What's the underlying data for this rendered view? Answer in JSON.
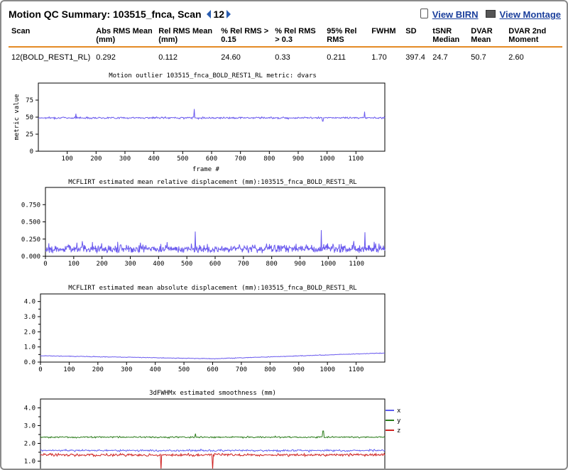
{
  "header": {
    "title_prefix": "Motion QC Summary: 103515_fnca, Scan",
    "scan_number": "12",
    "view_birn": "View BIRN",
    "view_montage": "View Montage"
  },
  "table": {
    "headers": [
      "Scan",
      "Abs RMS Mean (mm)",
      "Rel RMS Mean (mm)",
      "% Rel RMS > 0.15",
      "% Rel RMS > 0.3",
      "95% Rel RMS",
      "FWHM",
      "SD",
      "tSNR Median",
      "DVAR Mean",
      "DVAR 2nd Moment"
    ],
    "rows": [
      [
        "12(BOLD_REST1_RL)",
        "0.292",
        "0.112",
        "24.60",
        "0.33",
        "0.211",
        "1.70",
        "397.4",
        "24.7",
        "50.7",
        "2.60"
      ]
    ]
  },
  "colors": {
    "series": "#6a5aee",
    "x": "#5d5df0",
    "y": "#2c7d1c",
    "z": "#cf2323",
    "accent": "#e48a24"
  },
  "chart_data": [
    {
      "type": "line",
      "title": "Motion outlier 103515_fnca_BOLD_REST1_RL metric: dvars",
      "xlabel": "frame #",
      "ylabel": "metric value",
      "xlim": [
        0,
        1200
      ],
      "ylim": [
        0,
        100
      ],
      "yticks": [
        "0",
        "25",
        "50",
        "75"
      ],
      "xticks": [
        "100",
        "200",
        "300",
        "400",
        "500",
        "600",
        "700",
        "800",
        "900",
        "1000",
        "1100"
      ],
      "series": [
        {
          "values": {
            "base": 49,
            "noise": 1.2,
            "spikes": [
              [
                130,
                55
              ],
              [
                540,
                62
              ],
              [
                985,
                57
              ],
              [
                1130,
                58
              ]
            ],
            "dips": [
              [
                985,
                44
              ]
            ]
          }
        }
      ]
    },
    {
      "type": "line",
      "title": "MCFLIRT estimated mean relative displacement (mm):103515_fnca_BOLD_REST1_RL",
      "xlim": [
        0,
        1200
      ],
      "ylim": [
        0,
        1
      ],
      "yticks": [
        "0.000",
        "0.250",
        "0.500",
        "0.750"
      ],
      "xticks": [
        "0",
        "100",
        "200",
        "300",
        "400",
        "500",
        "600",
        "700",
        "800",
        "900",
        "1000",
        "1100"
      ],
      "series": [
        {
          "values": {
            "base": 0.11,
            "noise": 0.07,
            "spikes": [
              [
                130,
                0.22
              ],
              [
                530,
                0.36
              ],
              [
                975,
                0.38
              ],
              [
                1130,
                0.35
              ]
            ],
            "dips": []
          }
        }
      ]
    },
    {
      "type": "line",
      "title": "MCFLIRT estimated mean absolute displacement (mm):103515_fnca_BOLD_REST1_RL",
      "xlim": [
        0,
        1200
      ],
      "ylim": [
        0,
        4.5
      ],
      "yticks": [
        "0.0",
        "1.0",
        "2.0",
        "3.0",
        "4.0"
      ],
      "yticks_extra": [
        "0.5",
        "1.5",
        "2.5",
        "3.5"
      ],
      "xticks": [
        "0",
        "100",
        "200",
        "300",
        "400",
        "500",
        "600",
        "700",
        "800",
        "900",
        "1000",
        "1100"
      ],
      "series": [
        {
          "values": {
            "start": 0.42,
            "mid": 0.22,
            "end": 0.6,
            "noise": 0.02
          }
        }
      ]
    },
    {
      "type": "line",
      "title": "3dFWHMx estimated smoothness (mm)",
      "xlim": [
        0,
        1200
      ],
      "ylim": [
        0.5,
        4.5
      ],
      "yticks": [
        "1.0",
        "2.0",
        "3.0",
        "4.0"
      ],
      "yticks_extra": [
        "1.5",
        "2.5",
        "3.5"
      ],
      "series": [
        {
          "name": "x",
          "values": {
            "base": 1.6,
            "noise": 0.05
          }
        },
        {
          "name": "y",
          "values": {
            "base": 2.35,
            "noise": 0.04,
            "spikes": [
              [
                540,
                2.55
              ],
              [
                985,
                2.7
              ]
            ]
          }
        },
        {
          "name": "z",
          "values": {
            "base": 1.35,
            "noise": 0.07,
            "dips": [
              [
                420,
                0.2
              ],
              [
                600,
                0.2
              ]
            ]
          }
        }
      ]
    }
  ]
}
